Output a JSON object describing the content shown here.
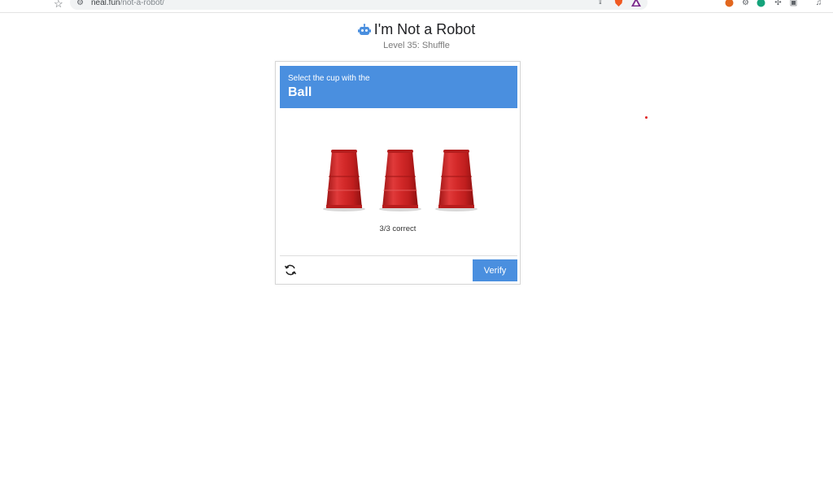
{
  "browser": {
    "url_host": "neal.fun",
    "url_path": "/not-a-robot/"
  },
  "header": {
    "title": "I'm Not a Robot",
    "subtitle": "Level 35: Shuffle"
  },
  "captcha": {
    "prompt": "Select the cup with the",
    "target": "Ball",
    "cups": [
      {
        "name": "cup-1"
      },
      {
        "name": "cup-2"
      },
      {
        "name": "cup-3"
      }
    ],
    "score": "3/3 correct",
    "verify_label": "Verify"
  },
  "colors": {
    "accent": "#4a8fdf",
    "cup": "#d42a2a"
  }
}
